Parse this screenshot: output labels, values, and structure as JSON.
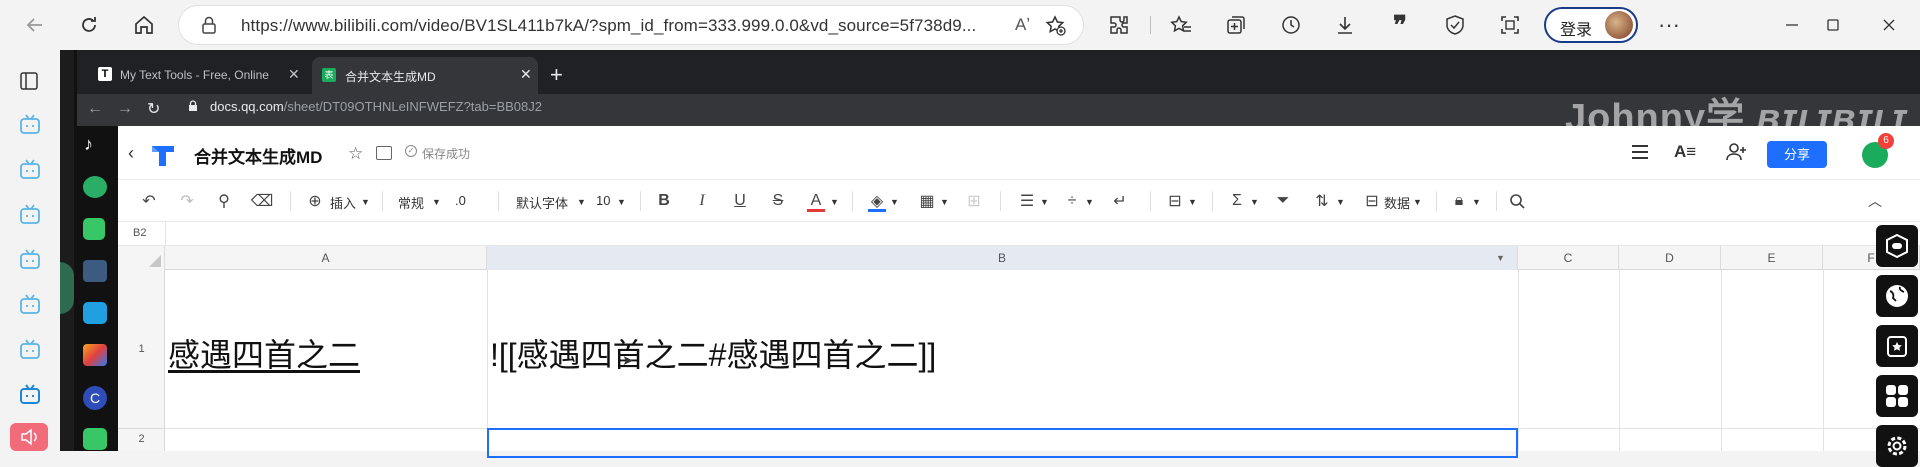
{
  "edge": {
    "url": "https://www.bilibili.com/video/BV1SL411b7kA/?spm_id_from=333.999.0.0&vd_source=5f738d9...",
    "read_aloud_label": "Aʼ",
    "login_label": "登录",
    "icons": [
      "back-icon",
      "refresh-icon",
      "home-icon",
      "lock-icon",
      "read-aloud-icon",
      "favorite-add-icon",
      "extensions-icon",
      "favorites-icon",
      "collections-icon",
      "history-icon",
      "downloads-icon",
      "quotes-icon",
      "browser-essentials-icon",
      "screenshot-icon",
      "more-icon",
      "minimize-icon",
      "maximize-icon",
      "close-icon"
    ]
  },
  "chrome": {
    "tabs": [
      {
        "title": "My Text Tools - Free, Online",
        "icon_letter": "T"
      },
      {
        "title": "合并文本生成MD",
        "icon_letter": "表"
      }
    ],
    "address_host": "docs.qq.com",
    "address_path": "/sheet/DT09OTHNLeINFWEFZ?tab=BB08J2"
  },
  "watermark": "Johnny学",
  "docs": {
    "title": "合并文本生成MD",
    "saved_status": "保存成功",
    "share_label": "分享",
    "notif_count": "6",
    "toolbar": {
      "insert": "插入",
      "format": "常规",
      "decimal": ".0",
      "font": "默认字体",
      "font_size": "10",
      "data": "数据"
    },
    "cell_ref": "B2",
    "columns": [
      "A",
      "B",
      "C",
      "D",
      "E",
      "F"
    ],
    "rows": [
      "1",
      "2"
    ],
    "cells": {
      "A1": "感遇四首之二",
      "B1": "![[感遇四首之二#感遇四首之二]]"
    }
  }
}
